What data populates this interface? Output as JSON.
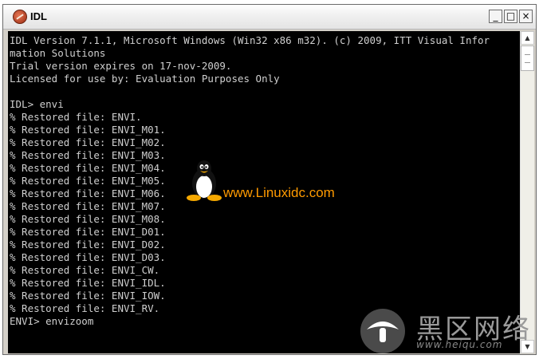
{
  "window": {
    "title": "IDL"
  },
  "controls": {
    "minimize": "_",
    "maximize": "□",
    "close": "×"
  },
  "console": {
    "lines": [
      "IDL Version 7.1.1, Microsoft Windows (Win32 x86 m32). (c) 2009, ITT Visual Infor",
      "mation Solutions",
      "Trial version expires on 17-nov-2009.",
      "Licensed for use by: Evaluation Purposes Only",
      "",
      "IDL> envi",
      "% Restored file: ENVI.",
      "% Restored file: ENVI_M01.",
      "% Restored file: ENVI_M02.",
      "% Restored file: ENVI_M03.",
      "% Restored file: ENVI_M04.",
      "% Restored file: ENVI_M05.",
      "% Restored file: ENVI_M06.",
      "% Restored file: ENVI_M07.",
      "% Restored file: ENVI_M08.",
      "% Restored file: ENVI_D01.",
      "% Restored file: ENVI_D02.",
      "% Restored file: ENVI_D03.",
      "% Restored file: ENVI_CW.",
      "% Restored file: ENVI_IDL.",
      "% Restored file: ENVI_IOW.",
      "% Restored file: ENVI_RV.",
      "ENVI> envizoom"
    ]
  },
  "scrollbar": {
    "up": "▲",
    "down": "▼"
  },
  "watermark": {
    "url": "www.Linuxidc.com"
  },
  "logo2": {
    "cn": "黑区网络",
    "url": "www.heiqu.com"
  },
  "colors": {
    "console_bg": "#000000",
    "console_text": "#cfcfcf",
    "watermark": "#ff9a00"
  }
}
